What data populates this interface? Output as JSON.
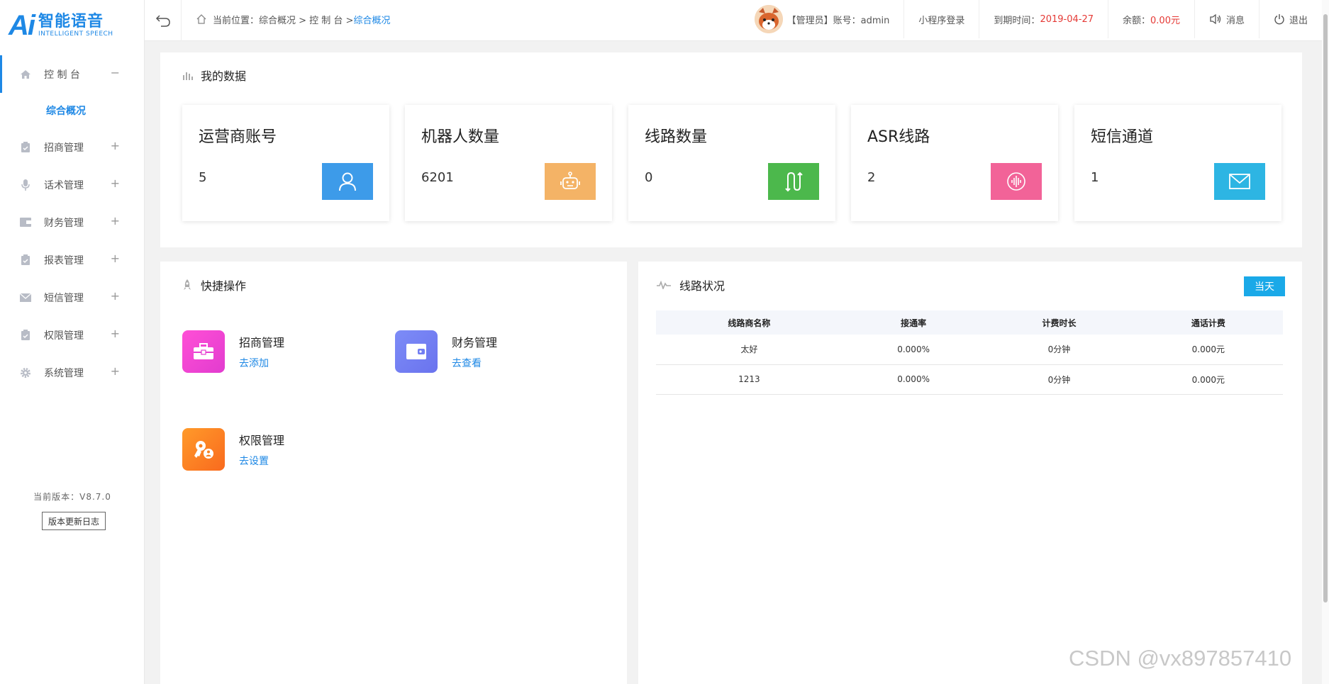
{
  "brand": {
    "ai": "Ai",
    "name_cn": "智能语音",
    "name_en": "INTELLIGENT SPEECH"
  },
  "sidebar": {
    "items": [
      {
        "label": "控 制 台",
        "icon": "home-icon",
        "toggle": "−"
      },
      {
        "label": "招商管理",
        "icon": "clipboard-icon",
        "toggle": "+"
      },
      {
        "label": "话术管理",
        "icon": "microphone-icon",
        "toggle": "+"
      },
      {
        "label": "财务管理",
        "icon": "wallet-icon",
        "toggle": "+"
      },
      {
        "label": "报表管理",
        "icon": "report-icon",
        "toggle": "+"
      },
      {
        "label": "短信管理",
        "icon": "mail-icon",
        "toggle": "+"
      },
      {
        "label": "权限管理",
        "icon": "permission-icon",
        "toggle": "+"
      },
      {
        "label": "系统管理",
        "icon": "gear-icon",
        "toggle": "+"
      }
    ],
    "sub_item": "综合概况",
    "version": "当前版本：V8.7.0",
    "changelog": "版本更新日志"
  },
  "header": {
    "crumb_prefix": "当前位置：综合概况 > 控 制 台 > ",
    "crumb_current": "综合概况",
    "account": "【管理员】账号：admin",
    "miniprogram": "小程序登录",
    "expire_label": "到期时间：",
    "expire_value": "2019-04-27",
    "balance_label": "余额：",
    "balance_value": "0.00元",
    "messages": "消息",
    "logout": "退出"
  },
  "mydata": {
    "title": "我的数据",
    "cards": [
      {
        "title": "运营商账号",
        "value": "5",
        "color": "#3d9be9",
        "icon": "user-icon"
      },
      {
        "title": "机器人数量",
        "value": "6201",
        "color": "#f4b366",
        "icon": "robot-icon"
      },
      {
        "title": "线路数量",
        "value": "0",
        "color": "#4cb84c",
        "icon": "route-icon"
      },
      {
        "title": "ASR线路",
        "value": "2",
        "color": "#f26398",
        "icon": "voice-icon"
      },
      {
        "title": "短信通道",
        "value": "1",
        "color": "#2db5e3",
        "icon": "envelope-icon"
      }
    ]
  },
  "quick": {
    "title": "快捷操作",
    "items": [
      {
        "name": "招商管理",
        "link": "去添加",
        "icon": "briefcase-icon"
      },
      {
        "name": "财务管理",
        "link": "去查看",
        "icon": "wallet-icon"
      },
      {
        "name": "权限管理",
        "link": "去设置",
        "icon": "key-user-icon"
      }
    ]
  },
  "lines": {
    "title": "线路状况",
    "today": "当天",
    "columns": [
      "线路商名称",
      "接通率",
      "计费时长",
      "通话计费"
    ],
    "rows": [
      [
        "太好",
        "0.000%",
        "0分钟",
        "0.000元"
      ],
      [
        "1213",
        "0.000%",
        "0分钟",
        "0.000元"
      ]
    ]
  },
  "watermark": "CSDN @vx897857410"
}
